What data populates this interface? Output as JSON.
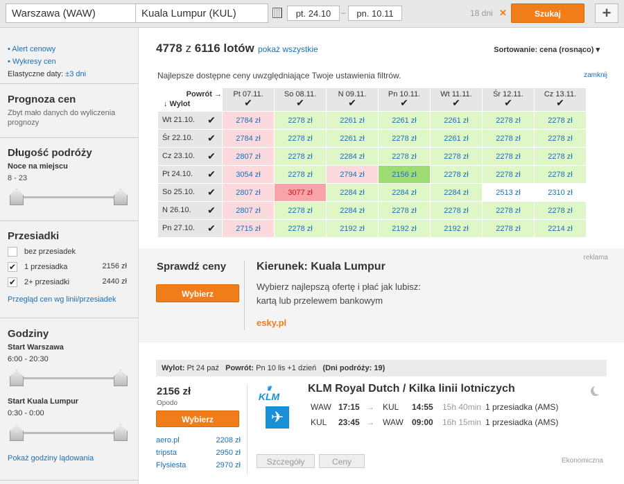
{
  "search": {
    "origin": "Warszawa (WAW)",
    "destination": "Kuala Lumpur (KUL)",
    "depart": "pt. 24.10",
    "sep": "–",
    "return": "pn. 10.11",
    "days": "18 dni",
    "close": "✕",
    "submit": "Szukaj",
    "plus": "+"
  },
  "sidebar": {
    "alert": "• Alert cenowy",
    "charts": "• Wykresy cen",
    "flex_label": "Elastyczne daty:",
    "flex_value": "±3 dni",
    "forecast_title": "Prognoza cen",
    "forecast_text": "Zbyt mało danych do wyliczenia prognozy",
    "duration_title": "Długość podróży",
    "duration_sub": "Noce na miejscu",
    "duration_min": "8",
    "duration_dash": "-",
    "duration_max": "23",
    "stops_title": "Przesiadki",
    "stops": [
      {
        "label": "bez przesiadek",
        "price": "",
        "checked": ""
      },
      {
        "label": "1 przesiadka",
        "price": "2156 zł",
        "checked": "✔"
      },
      {
        "label": "2+ przesiadki",
        "price": "2440 zł",
        "checked": "✔"
      }
    ],
    "stops_link": "Przegląd cen wg linii/przesiadek",
    "hours_title": "Godziny",
    "start_a": "Start Warszawa",
    "start_a_range": "6:00 - 20:30",
    "start_b": "Start Kuala Lumpur",
    "start_b_range": "0:30 - 0:00",
    "landing_link": "Pokaż godziny lądowania"
  },
  "results": {
    "count": "4778",
    "of": "z",
    "total": "6116 lotów",
    "show_all": "pokaż wszystkie",
    "sort": "Sortowanie: cena (rosnąco) ▾"
  },
  "grid": {
    "info": "Najlepsze dostępne ceny uwzględniające Twoje ustawienia filtrów.",
    "close": "zamknij",
    "powrot": "Powrót →",
    "wylot": "↓ Wylot",
    "cols": [
      "Pt 07.11.",
      "So 08.11.",
      "N 09.11.",
      "Pn 10.11.",
      "Wt 11.11.",
      "Śr 12.11.",
      "Cz 13.11."
    ],
    "rows": [
      {
        "label": "Wt 21.10.",
        "cells": [
          "2784 zł",
          "2278 zł",
          "2261 zł",
          "2261 zł",
          "2261 zł",
          "2278 zł",
          "2278 zł"
        ]
      },
      {
        "label": "Śr 22.10.",
        "cells": [
          "2784 zł",
          "2278 zł",
          "2261 zł",
          "2278 zł",
          "2261 zł",
          "2278 zł",
          "2278 zł"
        ]
      },
      {
        "label": "Cz 23.10.",
        "cells": [
          "2807 zł",
          "2278 zł",
          "2284 zł",
          "2278 zł",
          "2278 zł",
          "2278 zł",
          "2278 zł"
        ]
      },
      {
        "label": "Pt 24.10.",
        "cells": [
          "3054 zł",
          "2278 zł",
          "2794 zł",
          "2156 zł",
          "2278 zł",
          "2278 zł",
          "2278 zł"
        ]
      },
      {
        "label": "So 25.10.",
        "cells": [
          "2807 zł",
          "3077 zł",
          "2284 zł",
          "2284 zł",
          "2284 zł",
          "2513 zł",
          "2310 zł"
        ]
      },
      {
        "label": "N 26.10.",
        "cells": [
          "2807 zł",
          "2278 zł",
          "2284 zł",
          "2278 zł",
          "2278 zł",
          "2278 zł",
          "2278 zł"
        ]
      },
      {
        "label": "Pn 27.10.",
        "cells": [
          "2715 zł",
          "2278 zł",
          "2192 zł",
          "2192 zł",
          "2192 zł",
          "2278 zł",
          "2214 zł"
        ]
      }
    ]
  },
  "ad": {
    "reklama": "reklama",
    "check": "Sprawdź ceny",
    "button": "Wybierz",
    "title": "Kierunek: Kuala Lumpur",
    "text1": "Wybierz najlepszą ofertę i płać jak lubisz:",
    "text2": "kartą lub przelewem bankowym",
    "link": "esky.pl"
  },
  "result": {
    "wylot_l": "Wylot:",
    "wylot_v": "Pt 24 paź",
    "powrot_l": "Powrót:",
    "powrot_v": "Pn 10 lis +1 dzień",
    "dni_l": "(Dni podróży:",
    "dni_v": "19)",
    "price": "2156 zł",
    "vendor": "Opodo",
    "button": "Wybierz",
    "others": [
      {
        "name": "aero.pl",
        "price": "2208 zł"
      },
      {
        "name": "tripsta",
        "price": "2950 zł"
      },
      {
        "name": "Flysiesta",
        "price": "2970 zł"
      }
    ],
    "logo": "KLM",
    "airline": "KLM Royal Dutch",
    "airline2": "/ Kilka linii lotniczych",
    "legs": [
      {
        "from": "WAW",
        "dep": "17:15",
        "to": "KUL",
        "arr": "14:55",
        "dur": "15h 40min",
        "stops": "1 przesiadka (AMS)"
      },
      {
        "from": "KUL",
        "dep": "23:45",
        "to": "WAW",
        "arr": "09:00",
        "dur": "16h 15min",
        "stops": "1 przesiadka (AMS)"
      }
    ],
    "details": "Szczegóły",
    "prices": "Ceny",
    "class": "Ekonomiczna"
  },
  "colors": {
    "orange": "#f07d1a",
    "green": "#dff7c6",
    "pink": "#fbd9dd",
    "red": "#f8a3a8",
    "darkgreen": "#9ddc72",
    "link": "#1a6fb5"
  }
}
